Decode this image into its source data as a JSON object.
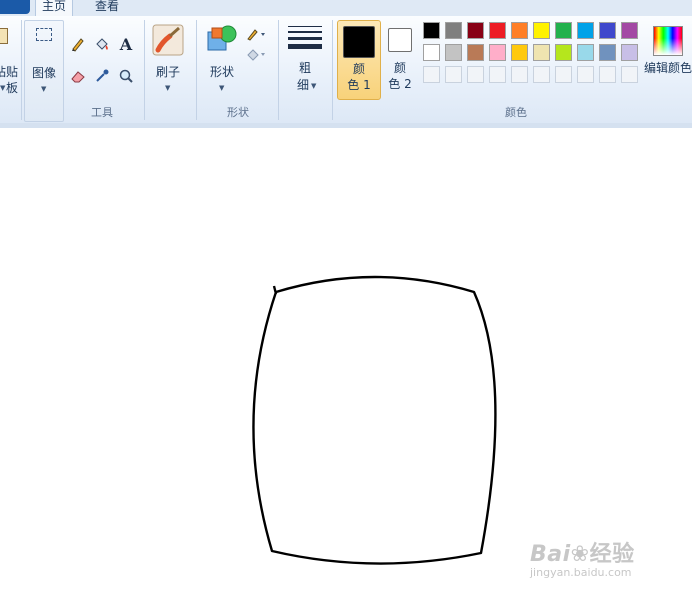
{
  "tabs": [
    {
      "label": "主页",
      "active": true
    },
    {
      "label": "查看",
      "active": false
    }
  ],
  "clipboard": {
    "label": "粘贴板"
  },
  "image": {
    "label": "图像"
  },
  "tools": {
    "group_label": "工具",
    "text_tool": "A"
  },
  "brushes": {
    "label": "刷子"
  },
  "shapes": {
    "label": "形状",
    "group_label": "形状"
  },
  "size": {
    "label_line1": "粗",
    "label_line2": "细"
  },
  "color1": {
    "label_line1": "颜",
    "label_line2": "色 1",
    "value": "#000000"
  },
  "color2": {
    "label_line1": "颜",
    "label_line2": "色 2",
    "value": "#ffffff"
  },
  "colors": {
    "group_label": "颜色",
    "row1": [
      "#000000",
      "#7f7f7f",
      "#880015",
      "#ed1c24",
      "#ff7f27",
      "#fff200",
      "#22b14c",
      "#00a2e8",
      "#3f48cc",
      "#a349a4"
    ],
    "row2": [
      "#ffffff",
      "#c3c3c3",
      "#b97a57",
      "#ffaec9",
      "#ffc90e",
      "#efe4b0",
      "#b5e61d",
      "#99d9ea",
      "#7092be",
      "#c8bfe7"
    ],
    "row3_empty_count": 10
  },
  "edit_colors": {
    "label": "编辑颜色"
  },
  "watermark": {
    "brand_prefix": "Bai",
    "brand_suffix": "经验",
    "url": "jingyan.baidu.com"
  }
}
